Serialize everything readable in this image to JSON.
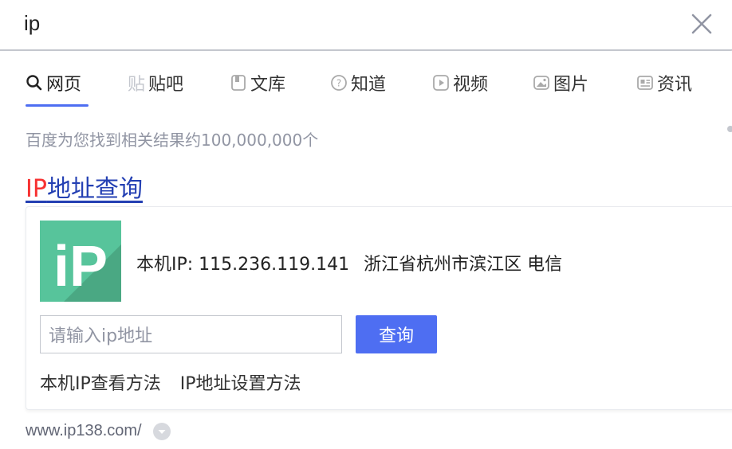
{
  "search": {
    "query": "ip"
  },
  "tabs": [
    {
      "label": "网页",
      "icon": "search-icon",
      "active": true
    },
    {
      "label": "贴吧",
      "icon": "tieba-icon",
      "icon_char": "贴",
      "active": false
    },
    {
      "label": "文库",
      "icon": "document-icon",
      "active": false
    },
    {
      "label": "知道",
      "icon": "question-icon",
      "active": false
    },
    {
      "label": "视频",
      "icon": "video-icon",
      "active": false
    },
    {
      "label": "图片",
      "icon": "image-icon",
      "active": false
    },
    {
      "label": "资讯",
      "icon": "news-icon",
      "active": false
    }
  ],
  "results": {
    "count_text": "百度为您找到相关结果约100,000,000个"
  },
  "result": {
    "title_highlight": "IP",
    "title_rest": "地址查询",
    "logo_text": "iP",
    "ip_text": "本机IP: 115.236.119.141",
    "location_text": "浙江省杭州市滨江区 电信",
    "input_placeholder": "请输入ip地址",
    "query_button": "查询",
    "links": [
      "本机IP查看方法",
      "IP地址设置方法"
    ],
    "url": "www.ip138.com/"
  },
  "colors": {
    "accent": "#4e6ef2",
    "title_link": "#2440b3",
    "highlight": "#f73131",
    "logo_green": "#57c49b"
  }
}
